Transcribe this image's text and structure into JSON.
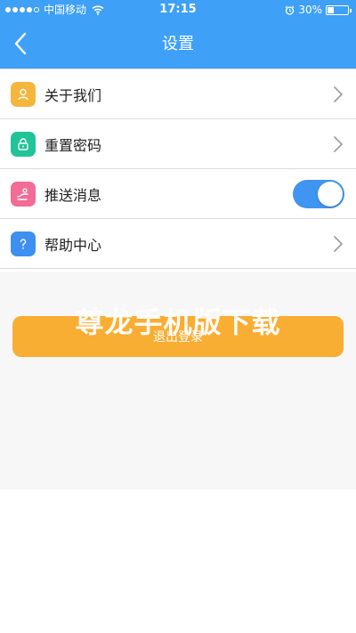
{
  "status_bar": {
    "carrier": "中国移动",
    "time": "17:15",
    "battery_percent": "30%",
    "battery_level": 0.3,
    "signal_bars": 4,
    "signal_total": 5
  },
  "nav": {
    "title": "设置",
    "back_icon": "chevron-left-icon"
  },
  "menu": {
    "items": [
      {
        "label": "关于我们",
        "icon": "user-icon",
        "icon_color": "#f4b63c",
        "control": "chevron"
      },
      {
        "label": "重置密码",
        "icon": "lock-icon",
        "icon_color": "#20c497",
        "control": "chevron"
      },
      {
        "label": "推送消息",
        "icon": "push-icon",
        "icon_color": "#f26c96",
        "control": "toggle",
        "toggle_on": true
      },
      {
        "label": "帮助中心",
        "icon": "question-icon",
        "icon_color": "#3d8ff0",
        "control": "chevron"
      }
    ]
  },
  "logout": {
    "label": "退出登录"
  },
  "watermark": {
    "text": "尊龙手机版下载"
  },
  "colors": {
    "header": "#3ea0f6",
    "logout_button": "#f8ad33",
    "toggle_on": "#3f95f0"
  }
}
